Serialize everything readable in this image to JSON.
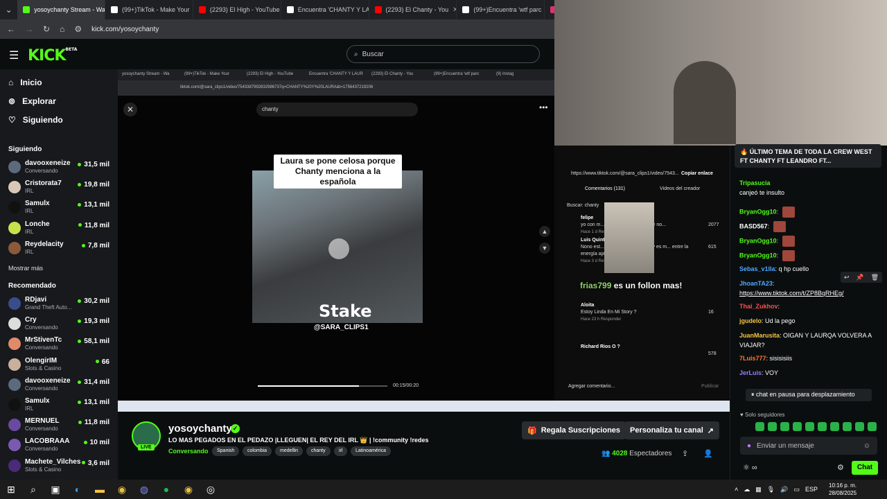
{
  "browser": {
    "tabs": [
      {
        "label": "yosoychanty Stream - Wa",
        "color": "#53fc18",
        "active": true
      },
      {
        "label": "(99+)TikTok - Make Your",
        "color": "#ffffff"
      },
      {
        "label": "(2293) El High - YouTube",
        "color": "#ff0000"
      },
      {
        "label": "Encuentra 'CHANTY Y LA",
        "color": "#ffffff"
      },
      {
        "label": "(2293) El Chanty - You",
        "color": "#ff0000"
      },
      {
        "label": "(99+)Encuentra 'wtf parc",
        "color": "#ffffff"
      },
      {
        "label": "(9) Instag",
        "color": "#e1306c"
      }
    ],
    "url": "kick.com/yosoychanty"
  },
  "header": {
    "logo": "KICK",
    "logo_beta": "BETA",
    "search_placeholder": "Buscar"
  },
  "sidebar": {
    "nav": [
      {
        "label": "Inicio",
        "icon": "home-icon"
      },
      {
        "label": "Explorar",
        "icon": "compass-icon"
      },
      {
        "label": "Siguiendo",
        "icon": "heart-icon"
      }
    ],
    "following_title": "Siguiendo",
    "following": [
      {
        "name": "davooxeneize",
        "category": "Conversando",
        "viewers": "31,5 mil",
        "color": "#5b6b7d"
      },
      {
        "name": "Cristorata7",
        "category": "IRL",
        "viewers": "19,8 mil",
        "color": "#d9c7b8"
      },
      {
        "name": "Samulx",
        "category": "IRL",
        "viewers": "13,1 mil",
        "color": "#111111"
      },
      {
        "name": "Lonche",
        "category": "IRL",
        "viewers": "11,8 mil",
        "color": "#c8e04a"
      },
      {
        "name": "Reydelacity",
        "category": "IRL",
        "viewers": "7,8 mil",
        "color": "#8a5a3a"
      }
    ],
    "show_more": "Mostrar más",
    "recommended_title": "Recomendado",
    "recommended": [
      {
        "name": "RDjavi",
        "category": "Grand Theft Auto...",
        "viewers": "30,2 mil",
        "color": "#3a4d8a"
      },
      {
        "name": "Cry",
        "category": "Conversando",
        "viewers": "19,3 mil",
        "color": "#dddddd"
      },
      {
        "name": "MrStivenTc",
        "category": "Conversando",
        "viewers": "58,1 mil",
        "color": "#e08a6a"
      },
      {
        "name": "OlengirIM",
        "category": "Slots & Casino",
        "viewers": "66",
        "color": "#c9b09a"
      },
      {
        "name": "davooxeneize",
        "category": "Conversando",
        "viewers": "31,4 mil",
        "color": "#5b6b7d"
      },
      {
        "name": "Samulx",
        "category": "IRL",
        "viewers": "13,1 mil",
        "color": "#111111"
      },
      {
        "name": "MERNUEL",
        "category": "Conversando",
        "viewers": "11,8 mil",
        "color": "#6a4aa0"
      },
      {
        "name": "LACOBRAAA",
        "category": "Conversando",
        "viewers": "10 mil",
        "color": "#7a5ab0"
      },
      {
        "name": "Machete_Vilches",
        "category": "Slots & Casino",
        "viewers": "3,6 mil",
        "color": "#4a2a7a"
      }
    ]
  },
  "stream_screen": {
    "inner_tabs": [
      "yosoychanty Stream - Wa",
      "(99+)TikTok - Make Your",
      "(2293) El High - YouTube",
      "Encuentra 'CHANTY Y LAUR",
      "(2293) El Chanty - You",
      "(99+)Encuentra 'wtf parc",
      "(9) Instag"
    ],
    "inner_url": "tiktok.com/@sara_clips1/video/7543387992832986737q=CHANTY%20Y%20LAURA&t=1756437219206",
    "tiktok_search": "chanty",
    "caption": "Laura se pone celosa porque Chanty menciona a la española",
    "watermark": "Stake",
    "username_overlay": "@SARA_CLIPS1",
    "video_time": "00:15/00:20",
    "video_progress": 0.78,
    "link_bar": "https://www.tiktok.com/@sara_clips1/video/7543...",
    "copy_link": "Copiar enlace",
    "tab_comments": "Comentarios (131)",
    "tab_creator": "Videos del creador",
    "search_label": "Buscar: chanty",
    "comments": [
      {
        "user": "felipe",
        "text": "yo con m... (veneca) cuando nadie no...",
        "meta": "Hace 1 d   Responder",
        "likes": "2077"
      },
      {
        "user": "Luis Quint...",
        "text": "Nono est... tensión de ese live hoy es m... entre la energía aja",
        "meta": "Hace 3 d   Responder",
        "likes": "615"
      },
      {
        "user": "Aloita",
        "text": "Estoy Linda En Mi Story ?",
        "meta": "Hace 23 h   Responder",
        "likes": "16"
      },
      {
        "user": "Richard Rios O ?",
        "text": "",
        "meta": "",
        "likes": "578"
      }
    ],
    "overlay_user": "frias799",
    "overlay_text": "es un follon mas!",
    "add_comment": "Agregar comentario...",
    "publish": "Publicar"
  },
  "stream_info": {
    "channel": "yosoychanty",
    "live_badge": "LIVE",
    "title": "LO MAS PEGADOS EN EL PEDAZO  |LLEGUEN| EL REY DEL IRL 👑 | !community !redes",
    "category": "Conversando",
    "tags": [
      "Spanish",
      "colombia",
      "medellin",
      "chanty",
      "irl",
      "Latinoamérica"
    ],
    "gift_button": "Regala Suscripciones",
    "customize_button": "Personaliza tu canal",
    "viewers": "4028",
    "viewers_label": "Espectadores"
  },
  "chat": {
    "pinned": "🔥 ÚLTIMO TEMA DE TODA LA CREW WEST FT CHANTY FT LEANDRO FT...",
    "messages": [
      {
        "user": "Tripasucia",
        "text": "canjeó te insulto",
        "color": "#53fc18"
      },
      {
        "user": "BryanOgg10",
        "text": "",
        "color": "#53fc18",
        "emote": true
      },
      {
        "user": "BASD567",
        "text": "",
        "color": "#ffffff",
        "emote": true
      },
      {
        "user": "BryanOgg10",
        "text": "",
        "color": "#53fc18",
        "emote": true
      },
      {
        "user": "BryanOgg10",
        "text": "",
        "color": "#53fc18",
        "emote": true
      },
      {
        "user": "Sebas_v1lla",
        "text": "q hp cuello",
        "color": "#4ea8ff"
      },
      {
        "user": "JhoanTA23",
        "text": "https://www.tiktok.com/t/ZP8BqRHEg/",
        "color": "#4ea8ff"
      },
      {
        "user": "Thai_Zukhov",
        "text": "",
        "color": "#ff4d4d"
      },
      {
        "user": "jgudelo",
        "text": "Ud la pego",
        "color": "#f5c542"
      },
      {
        "user": "JuanMarusita",
        "text": "OIGAN Y LAURQA VOLVERA A VIAJAR?",
        "color": "#f5c542"
      },
      {
        "user": "7Luis777",
        "text": "sisisisiis",
        "color": "#ff7a30"
      },
      {
        "user": "JerLuis",
        "text": "VOY",
        "color": "#9b7bff"
      }
    ],
    "paused": "chat en pausa para desplazamiento",
    "followers_only": "Solo seguidores",
    "input_placeholder": "Enviar un mensaje",
    "send_button": "Chat"
  },
  "taskbar": {
    "lang": "ESP",
    "time": "10:16 p. m.",
    "date": "28/08/2025"
  }
}
